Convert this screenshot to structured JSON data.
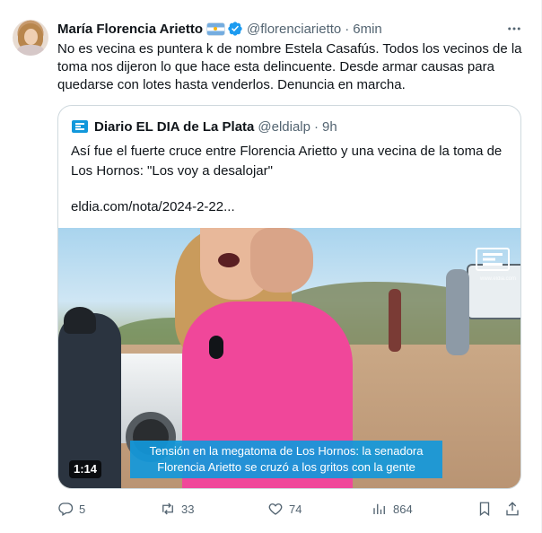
{
  "author": {
    "name": "María Florencia Arietto",
    "handle": "@florenciarietto",
    "separator": "·",
    "time": "6min",
    "flag_icon": "argentina-flag-icon",
    "verified_icon": "verified-badge-icon",
    "verified_color": "#1d9bf0"
  },
  "tweet": {
    "text": "No es vecina es puntera k de nombre Estela Casafús. Todos los vecinos de la toma nos dijeron lo que hace esta delincuente. Desde armar causas para quedarse con lotes hasta venderlos. Denuncia en marcha."
  },
  "quote": {
    "author_name": "Diario EL DIA de La Plata",
    "handle": "@eldialp",
    "separator": "·",
    "time": "9h",
    "logo_icon": "eldia-logo-icon",
    "text": "Así fue el fuerte cruce entre Florencia Arietto y una vecina de la toma de Los Hornos: \"Los voy a desalojar\"",
    "link": "eldia.com/nota/2024-2-22..."
  },
  "video": {
    "caption_line1": "Tensión en la megatoma de Los Hornos: la senadora",
    "caption_line2": "Florencia Arietto se cruzó a los gritos con la gente",
    "duration": "1:14",
    "channel_url": "www.eldia.com",
    "caption_color": "#1298db"
  },
  "actions": {
    "reply_count": "5",
    "retweet_count": "33",
    "like_count": "74",
    "views_count": "864",
    "icons": [
      "reply-icon",
      "retweet-icon",
      "like-icon",
      "views-icon",
      "bookmark-icon",
      "share-icon"
    ]
  },
  "colors": {
    "text_primary": "#0f1419",
    "text_secondary": "#536471",
    "border": "#cfd9de",
    "accent": "#1d9bf0"
  }
}
